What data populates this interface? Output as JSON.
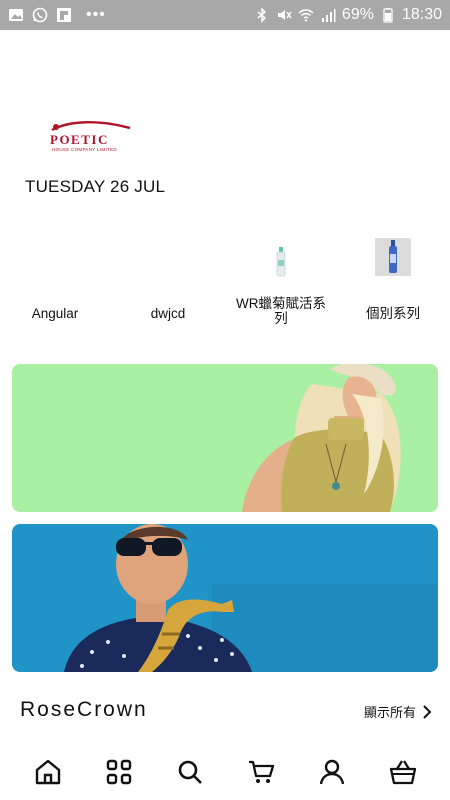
{
  "status_bar": {
    "battery": "69%",
    "time": "18:30",
    "left_icons": [
      "gallery-icon",
      "whatsapp-icon",
      "flipboard-icon",
      "more-dots-icon"
    ],
    "right_icons": [
      "bluetooth-icon",
      "mute-icon",
      "wifi-icon",
      "signal-icon"
    ]
  },
  "brand": {
    "logo_word": "POETIC",
    "logo_tagline": "HOUSE COMPANY LIMITED",
    "color": "#b0142b"
  },
  "date_label": "TUESDAY 26 JUL",
  "categories": [
    {
      "label": "Angular"
    },
    {
      "label": "dwjcd"
    },
    {
      "label": "WR蠟菊賦活系列"
    },
    {
      "label": "個別系列"
    }
  ],
  "banners": [
    {
      "name": "banner-woman",
      "bg": "#aaf0a3"
    },
    {
      "name": "banner-saxophone",
      "bg": "#2194c7"
    }
  ],
  "section": {
    "title": "RoseCrown",
    "see_all": "顯示所有"
  },
  "bottom_nav": [
    "home-icon",
    "grid-icon",
    "search-icon",
    "cart-icon",
    "account-icon",
    "basket-icon"
  ]
}
